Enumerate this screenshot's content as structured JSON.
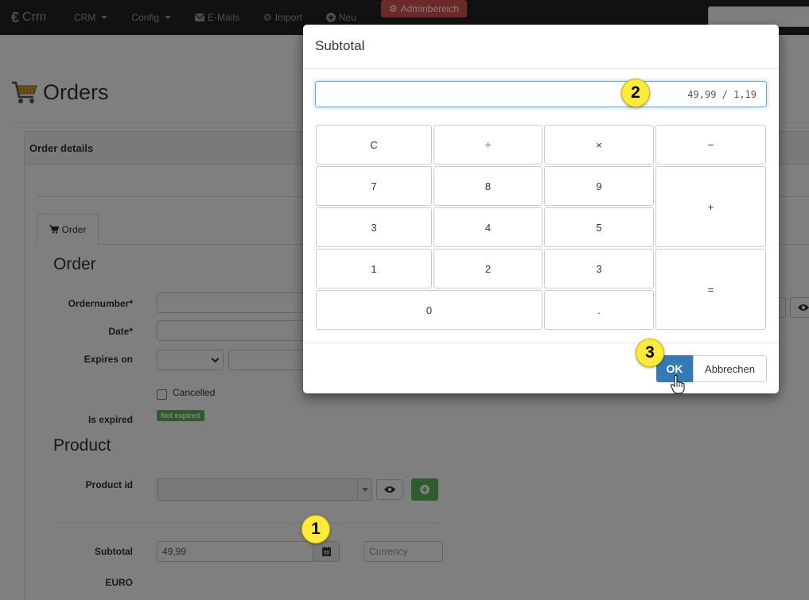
{
  "navbar": {
    "brand": "Crm",
    "brand_icon": "euro-icon",
    "items": [
      {
        "label": "CRM",
        "dropdown": true
      },
      {
        "label": "Config",
        "dropdown": true
      },
      {
        "label": "E-Mails",
        "icon": "envelope-icon"
      },
      {
        "label": "Import",
        "icon": "gear-icon"
      },
      {
        "label": "Neu",
        "icon": "plus-circle-icon"
      }
    ],
    "admin": {
      "label": "Adminbereich",
      "icon": "gear-icon",
      "color": "#d9534f"
    }
  },
  "page": {
    "title": "Orders",
    "title_icon": "cart-icon",
    "panel_heading": "Order details",
    "tab_label": "Order",
    "tab_icon": "cart-icon"
  },
  "order_section": {
    "heading": "Order",
    "ordernumber_label": "Ordernumber*",
    "date_label": "Date*",
    "expires_label": "Expires on",
    "cancelled_label": "Cancelled",
    "is_expired_label": "Is expired",
    "expired_badge": "Not expired"
  },
  "product_section": {
    "heading": "Product",
    "product_id_label": "Product id",
    "subtotal_label": "Subtotal",
    "subtotal_value": "49,99",
    "currency_placeholder": "Currency",
    "euro_label": "EURO"
  },
  "modal": {
    "title": "Subtotal",
    "display": "49,99 / 1,19",
    "buttons": {
      "clear": "C",
      "divide": "÷",
      "multiply": "×",
      "minus": "−",
      "seven": "7",
      "eight": "8",
      "nine": "9",
      "plus": "+",
      "row3_a": "3",
      "four": "4",
      "five": "5",
      "one": "1",
      "two": "2",
      "three": "3",
      "equals": "=",
      "zero": "0",
      "dot": "."
    },
    "ok_label": "OK",
    "cancel_label": "Abbrechen"
  },
  "markers": {
    "one": "1",
    "two": "2",
    "three": "3"
  },
  "colors": {
    "primary": "#337ab7",
    "success": "#5cb85c",
    "danger": "#d9534f",
    "marker": "#ffeb3b"
  }
}
